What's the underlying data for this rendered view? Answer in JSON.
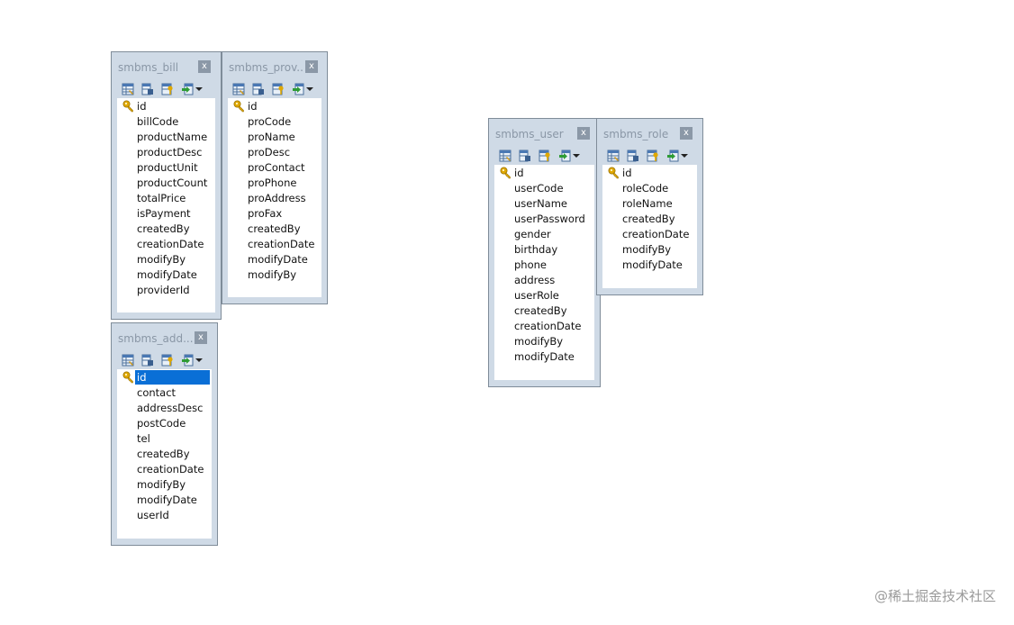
{
  "tables": {
    "bill": {
      "title": "smbms_bill",
      "close": "x",
      "fields": [
        "id",
        "billCode",
        "productName",
        "productDesc",
        "productUnit",
        "productCount",
        "totalPrice",
        "isPayment",
        "createdBy",
        "creationDate",
        "modifyBy",
        "modifyDate",
        "providerId"
      ]
    },
    "provider": {
      "title": "smbms_prov...",
      "close": "x",
      "fields": [
        "id",
        "proCode",
        "proName",
        "proDesc",
        "proContact",
        "proPhone",
        "proAddress",
        "proFax",
        "createdBy",
        "creationDate",
        "modifyDate",
        "modifyBy"
      ]
    },
    "address": {
      "title": "smbms_add...",
      "close": "x",
      "fields": [
        "id",
        "contact",
        "addressDesc",
        "postCode",
        "tel",
        "createdBy",
        "creationDate",
        "modifyBy",
        "modifyDate",
        "userId"
      ]
    },
    "user": {
      "title": "smbms_user",
      "close": "x",
      "fields": [
        "id",
        "userCode",
        "userName",
        "userPassword",
        "gender",
        "birthday",
        "phone",
        "address",
        "userRole",
        "createdBy",
        "creationDate",
        "modifyBy",
        "modifyDate"
      ]
    },
    "role": {
      "title": "smbms_role",
      "close": "x",
      "fields": [
        "id",
        "roleCode",
        "roleName",
        "createdBy",
        "creationDate",
        "modifyBy",
        "modifyDate"
      ]
    }
  },
  "icons": [
    "design-table-icon",
    "table-properties-icon",
    "index-key-icon",
    "import-arrow-icon",
    "dropdown-arrow-icon",
    "primary-key-icon"
  ],
  "colors": {
    "panel": "#cfdae6",
    "border": "#7f8c99",
    "selection": "#0a6fd6",
    "title": "#8a97a6",
    "key": "#e0a800"
  },
  "watermark": "@稀土掘金技术社区"
}
